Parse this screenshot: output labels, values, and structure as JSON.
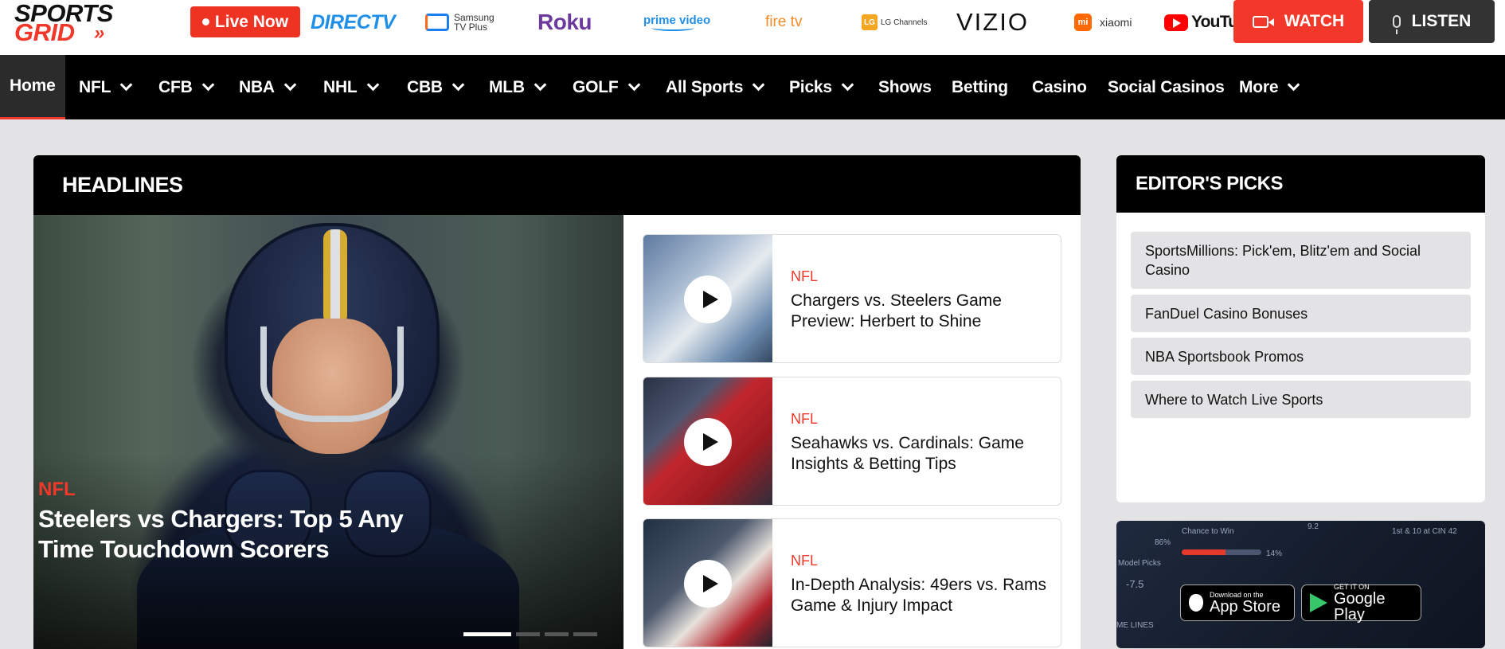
{
  "brand": {
    "line1": "SPORTS",
    "line2": "GRID",
    "chevrons": "»"
  },
  "topbar": {
    "live_label": "Live Now",
    "partners": {
      "directv": "DIRECTV",
      "samsung_line1": "Samsung",
      "samsung_line2": "TV Plus",
      "roku": "Roku",
      "prime": "prime video",
      "firetv": "fire tv",
      "lg": "LG Channels",
      "lg_mark": "LG",
      "vizio": "VIZIO",
      "xiaomi": "xiaomi",
      "xiaomi_mark": "mi",
      "youtube": "YouTube"
    },
    "watch_label": "WATCH",
    "listen_label": "LISTEN"
  },
  "nav": {
    "items": [
      {
        "label": "Home",
        "dropdown": false,
        "active": true
      },
      {
        "label": "NFL",
        "dropdown": true
      },
      {
        "label": "CFB",
        "dropdown": true
      },
      {
        "label": "NBA",
        "dropdown": true
      },
      {
        "label": "NHL",
        "dropdown": true
      },
      {
        "label": "CBB",
        "dropdown": true
      },
      {
        "label": "MLB",
        "dropdown": true
      },
      {
        "label": "GOLF",
        "dropdown": true
      },
      {
        "label": "All Sports",
        "dropdown": true
      },
      {
        "label": "Picks",
        "dropdown": true
      },
      {
        "label": "Shows",
        "dropdown": false
      },
      {
        "label": "Betting",
        "dropdown": false
      },
      {
        "label": "Casino",
        "dropdown": false
      },
      {
        "label": "Social Casinos",
        "dropdown": false
      },
      {
        "label": "More",
        "dropdown": true
      }
    ]
  },
  "headlines": {
    "title": "HEADLINES",
    "hero": {
      "category": "NFL",
      "title": "Steelers vs Chargers: Top 5 Any Time Touchdown Scorers"
    },
    "stories": [
      {
        "category": "NFL",
        "title": "Chargers vs. Steelers Game Preview: Herbert to Shine"
      },
      {
        "category": "NFL",
        "title": "Seahawks vs. Cardinals: Game Insights & Betting Tips"
      },
      {
        "category": "NFL",
        "title": "In-Depth Analysis: 49ers vs. Rams Game & Injury Impact"
      }
    ]
  },
  "editors_picks": {
    "title": "EDITOR'S PICKS",
    "items": [
      "SportsMillions: Pick'em, Blitz'em and Social Casino",
      "FanDuel Casino Bonuses",
      "NBA Sportsbook Promos",
      "Where to Watch Live Sports"
    ]
  },
  "app_promo": {
    "ghost_text": [
      "Chance to Win",
      "9.2",
      "1st & 10 at CIN 42",
      "86%",
      "14%",
      "Model Picks",
      "-7.5",
      "ME LINES"
    ],
    "app_store": {
      "small": "Download on the",
      "big": "App Store"
    },
    "google_play": {
      "small": "GET IT ON",
      "big": "Google Play"
    }
  },
  "colors": {
    "accent": "#f2382a",
    "nav_bg": "#000000",
    "page_bg": "#e3e2e4"
  }
}
